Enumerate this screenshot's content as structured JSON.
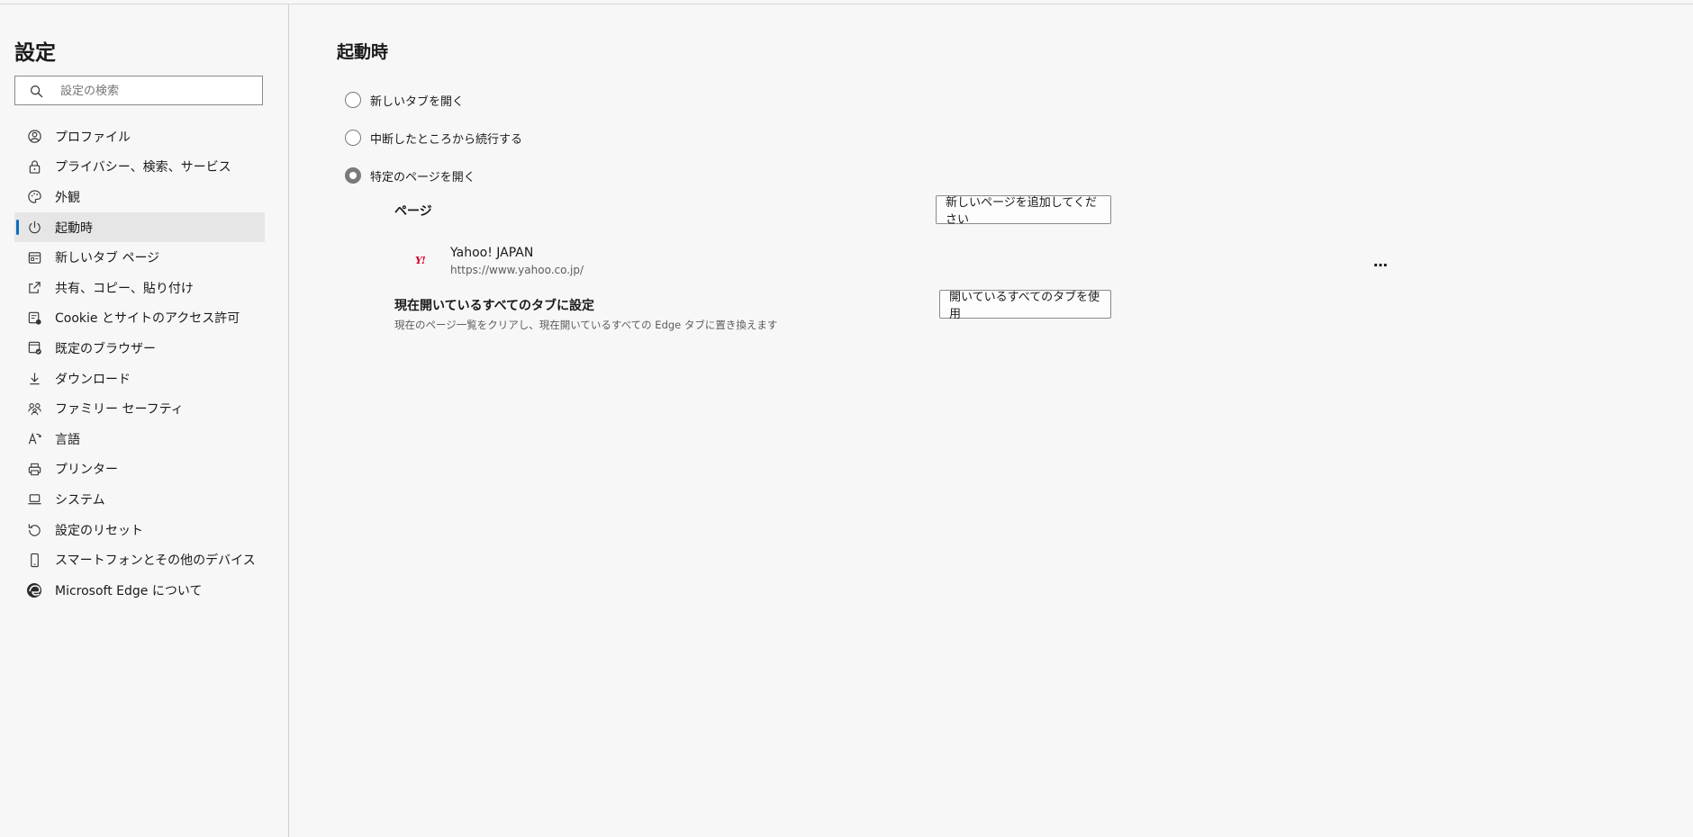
{
  "sidebar": {
    "title": "設定",
    "search": {
      "placeholder": "設定の検索",
      "value": ""
    },
    "items": [
      {
        "label": "プロファイル",
        "icon": "profile-icon"
      },
      {
        "label": "プライバシー、検索、サービス",
        "icon": "lock-icon"
      },
      {
        "label": "外観",
        "icon": "palette-icon"
      },
      {
        "label": "起動時",
        "icon": "power-icon",
        "active": true
      },
      {
        "label": "新しいタブ ページ",
        "icon": "new-tab-page-icon"
      },
      {
        "label": "共有、コピー、貼り付け",
        "icon": "share-icon"
      },
      {
        "label": "Cookie とサイトのアクセス許可",
        "icon": "cookie-permissions-icon"
      },
      {
        "label": "既定のブラウザー",
        "icon": "default-browser-icon"
      },
      {
        "label": "ダウンロード",
        "icon": "download-icon"
      },
      {
        "label": "ファミリー セーフティ",
        "icon": "family-icon"
      },
      {
        "label": "言語",
        "icon": "language-icon"
      },
      {
        "label": "プリンター",
        "icon": "printer-icon"
      },
      {
        "label": "システム",
        "icon": "laptop-icon"
      },
      {
        "label": "設定のリセット",
        "icon": "reset-icon"
      },
      {
        "label": "スマートフォンとその他のデバイス",
        "icon": "phone-icon"
      },
      {
        "label": "Microsoft Edge について",
        "icon": "edge-logo-icon"
      }
    ]
  },
  "main": {
    "title": "起動時",
    "options": [
      {
        "label": "新しいタブを開く",
        "checked": false
      },
      {
        "label": "中断したところから続行する",
        "checked": false
      },
      {
        "label": "特定のページを開く",
        "checked": true
      }
    ],
    "pages_label": "ページ",
    "add_page_button": "新しいページを追加してください",
    "pages": [
      {
        "name": "Yahoo! JAPAN",
        "url": "https://www.yahoo.co.jp/",
        "favicon_text": "Y!",
        "favicon_color": "#d4002d"
      }
    ],
    "more_button": "…",
    "all_tabs": {
      "title": "現在開いているすべてのタブに設定",
      "description": "現在のページ一覧をクリアし、現在開いているすべての Edge タブに置き換えます",
      "button": "開いているすべてのタブを使用"
    }
  },
  "colors": {
    "accent": "#0f6cbd",
    "background": "#f7f7f7",
    "active_item_bg": "#e6e6e6"
  }
}
